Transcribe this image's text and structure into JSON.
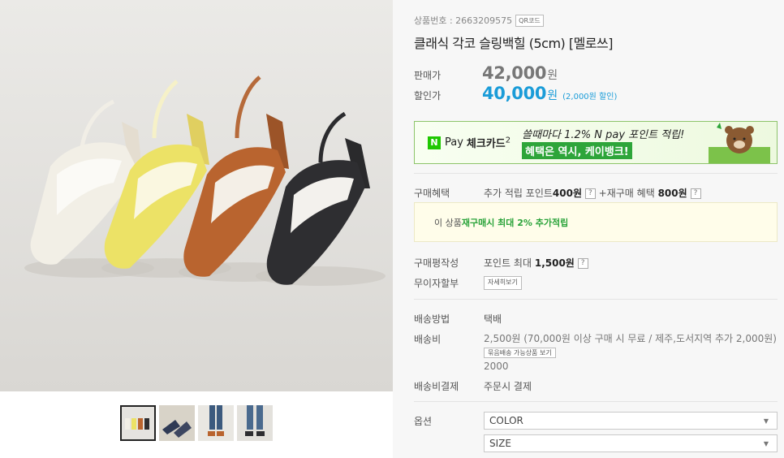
{
  "product": {
    "number_label": "상품번호 : 2663209575",
    "qr_label": "QR코드",
    "title": "클래식 각코 슬링백힐 (5cm) [멜로쓰]"
  },
  "price": {
    "original_label": "판매가",
    "original_value": "42,000",
    "sale_label": "할인가",
    "sale_value": "40,000",
    "currency": "원",
    "discount_note": "(2,000원 할인)"
  },
  "npay": {
    "n": "N",
    "pay": "Pay",
    "card": "체크카드",
    "card_sup": "2",
    "promo_line1": "쓸때마다 1.2% N pay 포인트 적립!",
    "promo_line2": "혜택은 역시, 케이뱅크!"
  },
  "benefit": {
    "label": "구매혜택",
    "text1": "추가 적립 포인트",
    "points": "400원",
    "text2": "+재구매 혜택",
    "rebuy": "800원",
    "q": "?"
  },
  "notice": {
    "prefix": "이 상품 ",
    "highlight": "재구매시 최대 2% 추가적립"
  },
  "review": {
    "label": "구매평작성",
    "text": "포인트 최대",
    "value": "1,500원",
    "q": "?"
  },
  "installment": {
    "label": "무이자할부",
    "button": "자세히보기"
  },
  "shipping": {
    "method_label": "배송방법",
    "method_value": "택배",
    "fee_label": "배송비",
    "fee_text": "2,500원 (70,000원 이상 구매 시 무료 / 제주,도서지역 추가 2,000원)",
    "fee_button": "묶음배송 가능상품 보기",
    "fee_extra": "2000",
    "pay_label": "배송비결제",
    "pay_value": "주문시 결제"
  },
  "options": {
    "label": "옵션",
    "color": "COLOR",
    "size": "SIZE"
  },
  "colors": {
    "accent": "#1a9cd8",
    "npay_green": "#1ec800",
    "highlight_green": "#2aa33a"
  }
}
